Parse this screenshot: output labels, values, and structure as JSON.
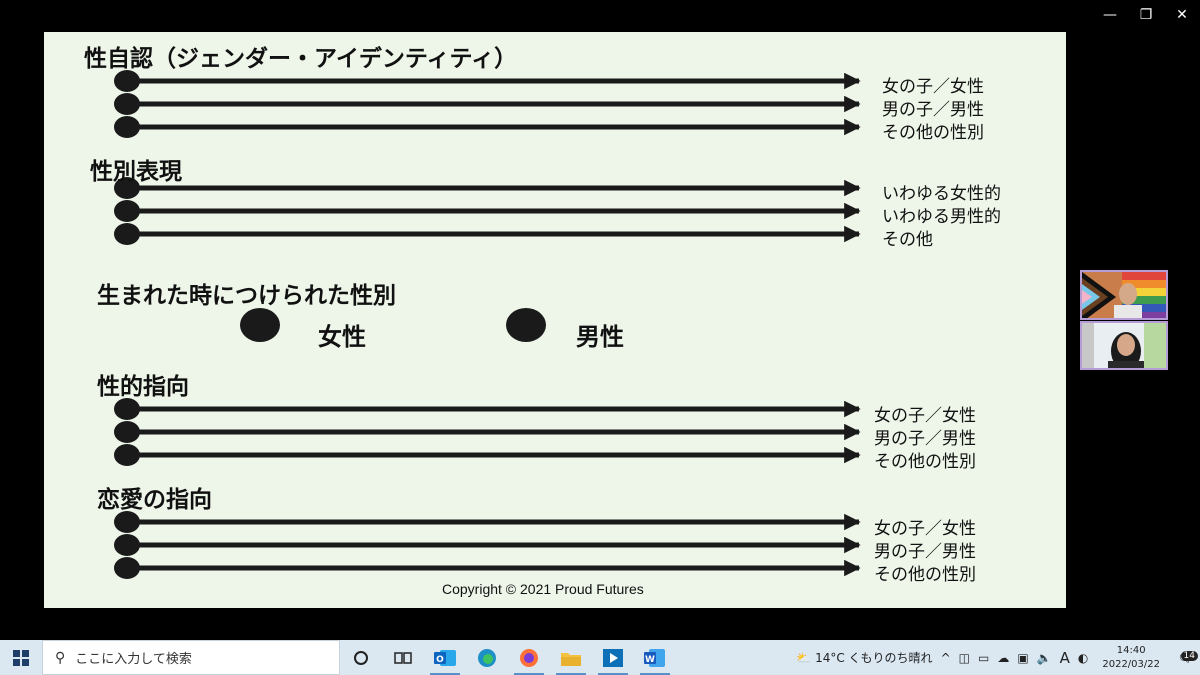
{
  "window": {
    "minimize": "—",
    "restore": "❐",
    "close": "✕"
  },
  "slide": {
    "gender_identity": {
      "title": "性自認（ジェンダー・アイデンティティ）",
      "labels": [
        "女の子／女性",
        "男の子／男性",
        "その他の性別"
      ]
    },
    "gender_expression": {
      "title": "性別表現",
      "labels": [
        "いわゆる女性的",
        "いわゆる男性的",
        "その他"
      ]
    },
    "assigned_sex": {
      "title": "生まれた時につけられた性別",
      "female": "女性",
      "male": "男性"
    },
    "sexual_orientation": {
      "title": "性的指向",
      "labels": [
        "女の子／女性",
        "男の子／男性",
        "その他の性別"
      ]
    },
    "romantic_orientation": {
      "title": "恋愛の指向",
      "labels": [
        "女の子／女性",
        "男の子／男性",
        "その他の性別"
      ]
    },
    "copyright": "Copyright © 2021 Proud Futures"
  },
  "taskbar": {
    "search_placeholder": "ここに入力して検索",
    "weather": "14°C  くもりのち晴れ",
    "ime": "A",
    "time": "14:40",
    "date": "2022/03/22",
    "notification_count": "14"
  }
}
